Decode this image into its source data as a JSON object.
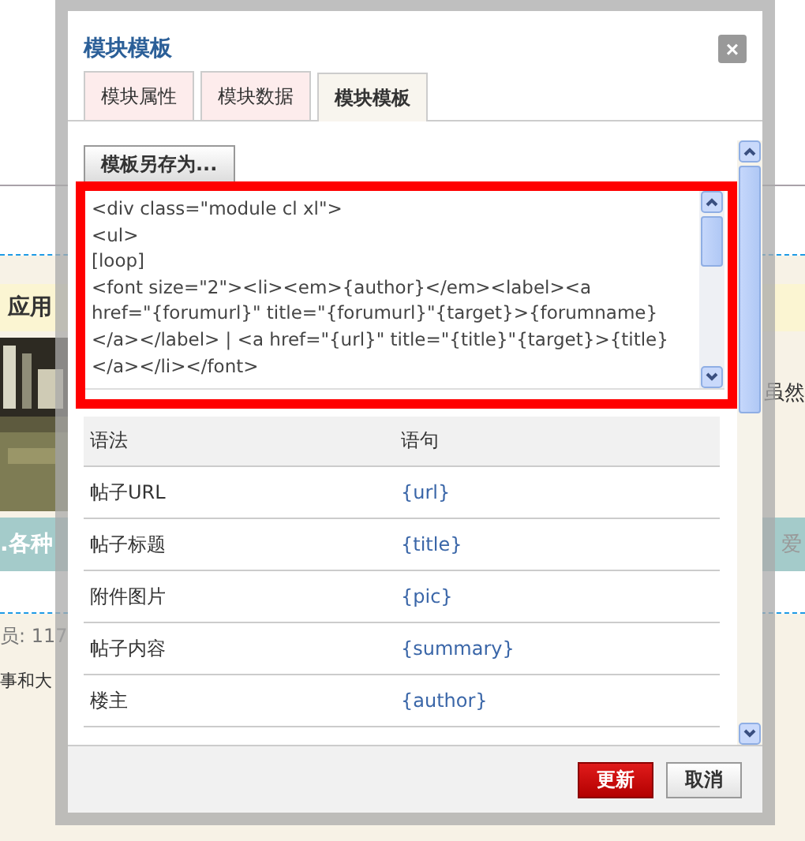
{
  "background": {
    "band_label": "应用",
    "side_text": "虽然",
    "caption": ".各种",
    "side_text_2": "爱",
    "members": "员: 117",
    "footer_text": "事和大"
  },
  "dialog": {
    "title": "模块模板",
    "close": "×",
    "tabs": [
      {
        "label": "模块属性",
        "selected": false
      },
      {
        "label": "模块数据",
        "selected": false
      },
      {
        "label": "模块模板",
        "selected": true
      }
    ],
    "save_as_button": "模板另存为...",
    "code_lines": [
      "<div class=\"module cl xl\">",
      "<ul>",
      "[loop]",
      "<font size=\"2\"><li><em>{author}</em><label><a",
      "href=\"{forumurl}\" title=\"{forumurl}\"{target}>{forumname}",
      "</a></label> | <a href=\"{url}\" title=\"{title}\"{target}>{title}",
      "</a></li></font>"
    ],
    "table": {
      "columns": [
        "语法",
        "语句"
      ],
      "rows": [
        [
          "帖子URL",
          "{url}"
        ],
        [
          "帖子标题",
          "{title}"
        ],
        [
          "附件图片",
          "{pic}"
        ],
        [
          "帖子内容",
          "{summary}"
        ],
        [
          "楼主",
          "{author}"
        ]
      ]
    },
    "buttons": [
      {
        "label": "更新",
        "kind": "primary"
      },
      {
        "label": "取消",
        "kind": "secondary"
      }
    ]
  }
}
